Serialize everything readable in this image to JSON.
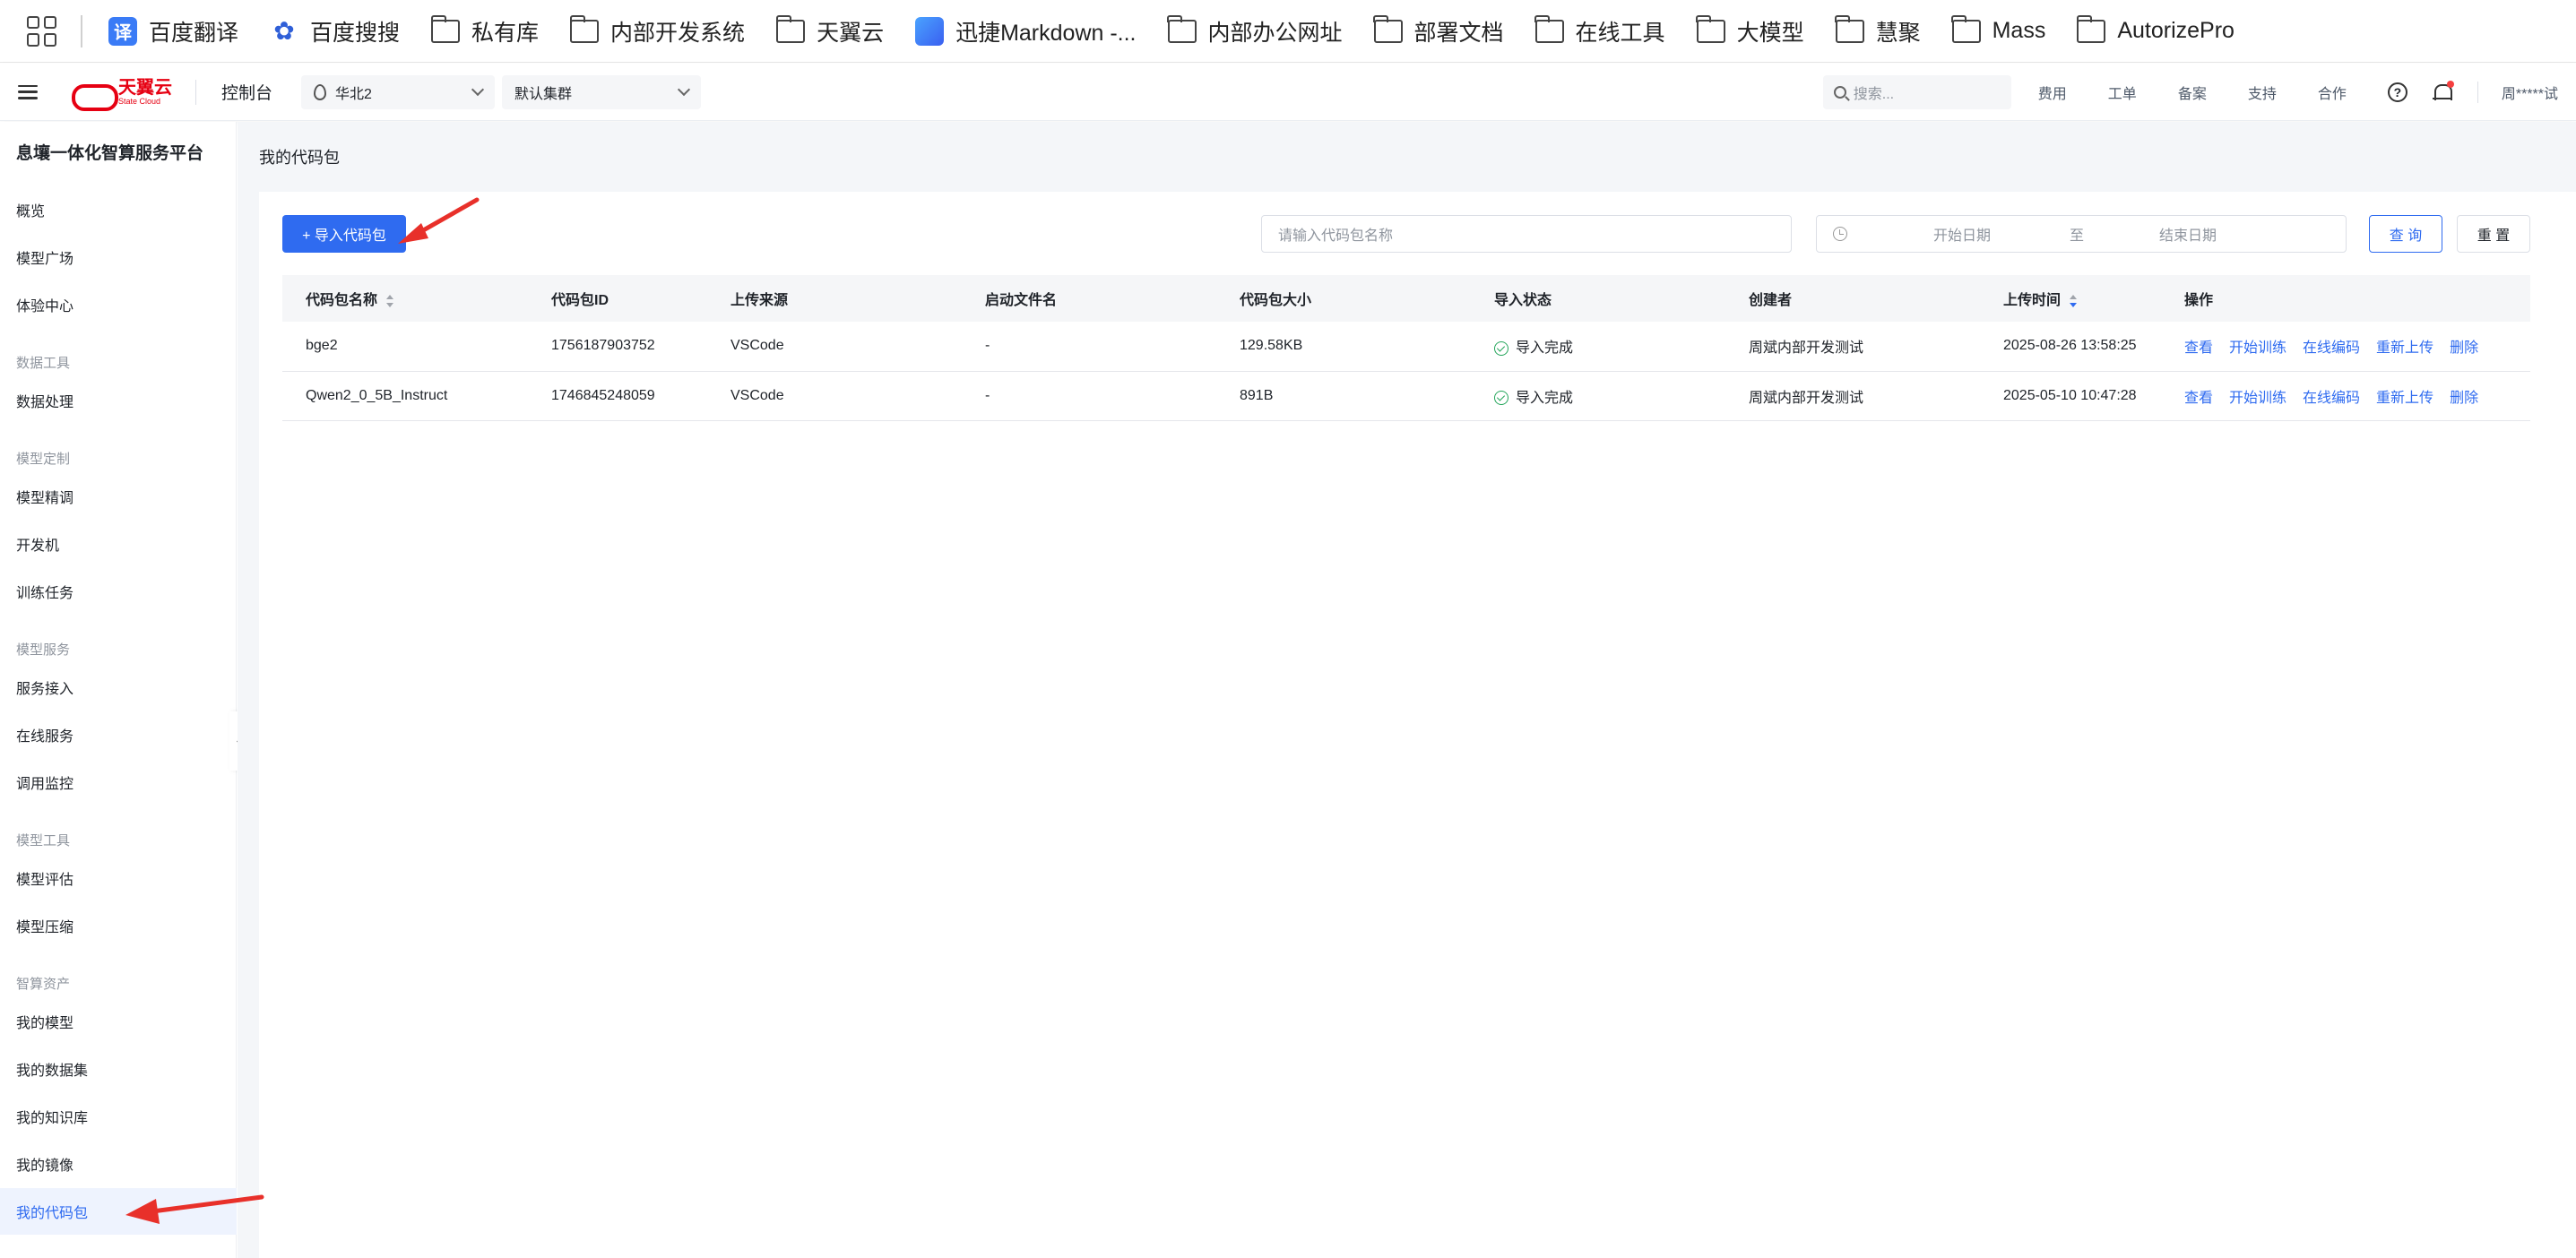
{
  "bookmarks": [
    {
      "label": "百度翻译",
      "icon": "translate-icon"
    },
    {
      "label": "百度搜搜",
      "icon": "baidu-paw-icon"
    },
    {
      "label": "私有库",
      "icon": "folder-icon"
    },
    {
      "label": "内部开发系统",
      "icon": "folder-icon"
    },
    {
      "label": "天翼云",
      "icon": "folder-icon"
    },
    {
      "label": "迅捷Markdown -...",
      "icon": "markdown-icon"
    },
    {
      "label": "内部办公网址",
      "icon": "folder-icon"
    },
    {
      "label": "部署文档",
      "icon": "folder-icon"
    },
    {
      "label": "在线工具",
      "icon": "folder-icon"
    },
    {
      "label": "大模型",
      "icon": "folder-icon"
    },
    {
      "label": "慧聚",
      "icon": "folder-icon"
    },
    {
      "label": "Mass",
      "icon": "folder-icon"
    },
    {
      "label": "AutorizePro",
      "icon": "folder-icon"
    }
  ],
  "translate_glyph": "译",
  "header": {
    "logo_cn": "天翼云",
    "logo_en": "State Cloud",
    "console": "控制台",
    "region": "华北2",
    "cluster": "默认集群",
    "search_placeholder": "搜索...",
    "links": [
      "费用",
      "工单",
      "备案",
      "支持",
      "合作"
    ],
    "help_glyph": "?",
    "user": "周*****试"
  },
  "sidebar": {
    "title": "息壤一体化智算服务平台",
    "items": [
      {
        "type": "item",
        "label": "概览"
      },
      {
        "type": "item",
        "label": "模型广场"
      },
      {
        "type": "item",
        "label": "体验中心"
      },
      {
        "type": "group",
        "label": "数据工具"
      },
      {
        "type": "item",
        "label": "数据处理"
      },
      {
        "type": "group",
        "label": "模型定制"
      },
      {
        "type": "item",
        "label": "模型精调"
      },
      {
        "type": "item",
        "label": "开发机"
      },
      {
        "type": "item",
        "label": "训练任务"
      },
      {
        "type": "group",
        "label": "模型服务"
      },
      {
        "type": "item",
        "label": "服务接入"
      },
      {
        "type": "item",
        "label": "在线服务"
      },
      {
        "type": "item",
        "label": "调用监控"
      },
      {
        "type": "group",
        "label": "模型工具"
      },
      {
        "type": "item",
        "label": "模型评估"
      },
      {
        "type": "item",
        "label": "模型压缩"
      },
      {
        "type": "group",
        "label": "智算资产"
      },
      {
        "type": "item",
        "label": "我的模型"
      },
      {
        "type": "item",
        "label": "我的数据集"
      },
      {
        "type": "item",
        "label": "我的知识库"
      },
      {
        "type": "item",
        "label": "我的镜像"
      },
      {
        "type": "item",
        "label": "我的代码包",
        "active": true
      }
    ]
  },
  "main": {
    "page_title": "我的代码包",
    "import_button": "+ 导入代码包",
    "name_placeholder": "请输入代码包名称",
    "date_start": "开始日期",
    "date_to": "至",
    "date_end": "结束日期",
    "query_button": "查 询",
    "reset_button": "重 置",
    "columns": [
      "代码包名称",
      "代码包ID",
      "上传来源",
      "启动文件名",
      "代码包大小",
      "导入状态",
      "创建者",
      "上传时间",
      "操作"
    ],
    "rows": [
      {
        "name": "bge2",
        "id": "1756187903752",
        "source": "VSCode",
        "entry": "-",
        "size": "129.58KB",
        "status": "导入完成",
        "creator": "周斌内部开发测试",
        "time": "2025-08-26 13:58:25"
      },
      {
        "name": "Qwen2_0_5B_Instruct",
        "id": "1746845248059",
        "source": "VSCode",
        "entry": "-",
        "size": "891B",
        "status": "导入完成",
        "creator": "周斌内部开发测试",
        "time": "2025-05-10 10:47:28"
      }
    ],
    "actions": [
      "查看",
      "开始训练",
      "在线编码",
      "重新上传",
      "删除"
    ]
  },
  "colors": {
    "accent": "#2f6bf0",
    "brand": "#e60012",
    "success": "#23a55a",
    "annotation_arrow": "#e8302a"
  }
}
